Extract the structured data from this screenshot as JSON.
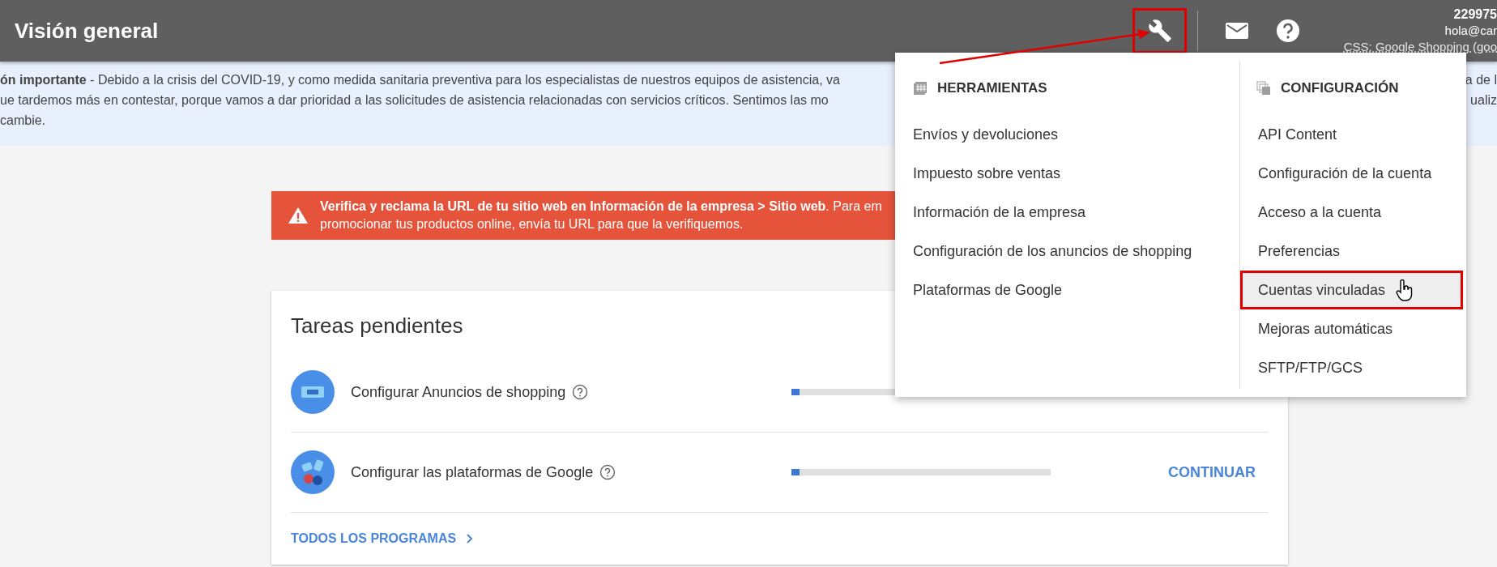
{
  "top_bar": {
    "title": "Visión general",
    "account": {
      "id": "229975",
      "email": "hola@car",
      "subaccount": "CSS: Google Shopping (goo"
    }
  },
  "notice": {
    "lines": [
      {
        "left": "**ón importante** - Debido a la crisis del COVID-19, y como medida sanitaria preventiva para los especialistas de nuestros equipos de asistencia, va",
        "right": "a de l"
      },
      {
        "left": "ue tardemos más en contestar, porque vamos a dar prioridad a las solicitudes de asistencia relacionadas con servicios críticos. Sentimos las mo",
        "right": "ualiz"
      },
      {
        "left": "cambie."
      }
    ]
  },
  "alert": {
    "lines": [
      "**Verifica y reclama la URL de tu sitio web en Información de la empresa > Sitio web**. Para em",
      "promocionar tus productos online, envía tu URL para que la verifiquemos."
    ]
  },
  "tasks": {
    "title": "Tareas pendientes",
    "rows": [
      {
        "label": "Configurar Anuncios de shopping",
        "level": 0.03
      },
      {
        "label": "Configurar las plataformas de Google",
        "level": 0.03,
        "action": "CONTINUAR"
      }
    ],
    "link": "TODOS LOS PROGRAMAS"
  },
  "menu": {
    "columns": [
      {
        "header": "HERRAMIENTAS",
        "items": [
          {
            "label": "Envíos y devoluciones",
            "selected": false
          },
          {
            "label": "Impuesto sobre ventas",
            "selected": false
          },
          {
            "label": "Información de la empresa",
            "selected": false
          },
          {
            "label": "Configuración de los anuncios de shopping",
            "selected": false
          },
          {
            "label": "Plataformas de Google",
            "selected": false
          }
        ]
      },
      {
        "header": "CONFIGURACIÓN",
        "items": [
          {
            "label": "API Content",
            "selected": false
          },
          {
            "label": "Configuración de la cuenta",
            "selected": false
          },
          {
            "label": "Acceso a la cuenta",
            "selected": false
          },
          {
            "label": "Preferencias",
            "selected": false
          },
          {
            "label": "Cuentas vinculadas",
            "selected": true
          },
          {
            "label": "Mejoras automáticas",
            "selected": false
          },
          {
            "label": "SFTP/FTP/GCS",
            "selected": false
          }
        ]
      }
    ]
  }
}
